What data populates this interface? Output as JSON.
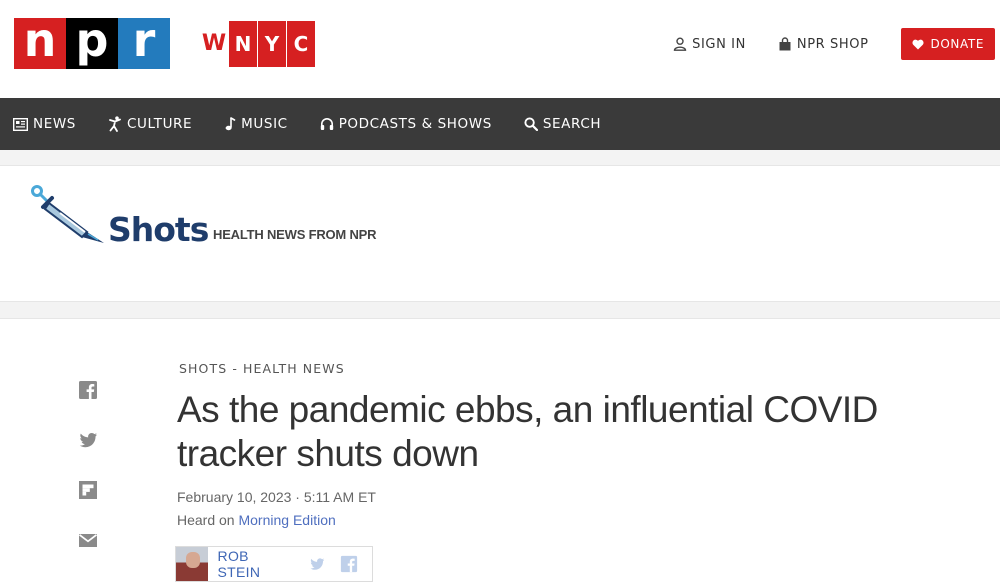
{
  "brand": {
    "npr_letters": [
      "n",
      "p",
      "r"
    ],
    "station_letters": [
      "W",
      "N",
      "Y",
      "C"
    ]
  },
  "utility": {
    "sign_in": "SIGN IN",
    "shop": "NPR SHOP",
    "donate": "DONATE"
  },
  "nav": {
    "items": [
      {
        "label": "NEWS",
        "icon": "newspaper-icon"
      },
      {
        "label": "CULTURE",
        "icon": "culture-icon"
      },
      {
        "label": "MUSIC",
        "icon": "music-note-icon"
      },
      {
        "label": "PODCASTS & SHOWS",
        "icon": "headphones-icon"
      },
      {
        "label": "SEARCH",
        "icon": "search-icon"
      }
    ]
  },
  "section": {
    "name": "Shots",
    "tagline": "HEALTH NEWS FROM NPR"
  },
  "article": {
    "slug": "SHOTS - HEALTH NEWS",
    "headline": "As the pandemic ebbs, an influential COVID tracker shuts down",
    "date": "February 10, 2023 · 5:11 AM ET",
    "heard_prefix": "Heard on ",
    "heard_program": "Morning Edition",
    "author": "ROB STEIN"
  },
  "colors": {
    "npr_red": "#d62021",
    "npr_blue": "#237bbd",
    "nav_bg": "#3a3a3a",
    "shots_navy": "#1f3d6b",
    "link_blue": "#4f6fbf"
  }
}
